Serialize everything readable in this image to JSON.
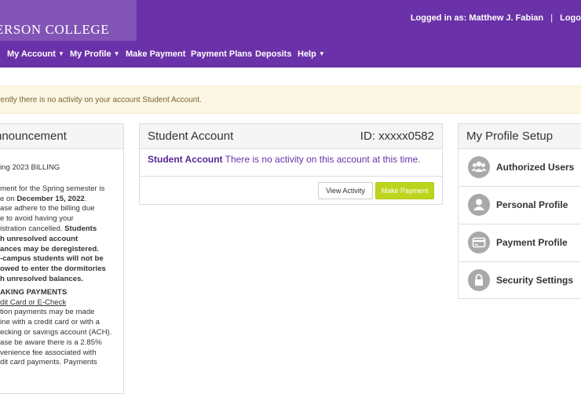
{
  "header": {
    "logo_text": "ERSON COLLEGE",
    "login_prefix": "Logged in as:",
    "user_name": "Matthew J. Fabian",
    "separator": "|",
    "logout_label": "Logo"
  },
  "nav": {
    "items": [
      {
        "label": "My Account",
        "dropdown": true
      },
      {
        "label": "My Profile",
        "dropdown": true
      },
      {
        "label": "Make Payment",
        "dropdown": false
      },
      {
        "label": "Payment Plans",
        "dropdown": false
      },
      {
        "label": "Deposits",
        "dropdown": false
      },
      {
        "label": "Help",
        "dropdown": true
      }
    ]
  },
  "alert": {
    "text": "rrently there is no activity on your account Student Account."
  },
  "announcement": {
    "title": "nnouncement",
    "heading": "ing 2023 BILLING",
    "para1_a": "ment for the Spring semester is",
    "para1_b": "e on ",
    "due_date": "December 15, 2022",
    "para1_c": ".",
    "para1_d": "ase adhere to the billing due",
    "para1_e": "e to avoid having your",
    "para1_f": "istration cancelled. ",
    "bold_1": "Students",
    "bold_2": "h unresolved account",
    "bold_3": "ances may be deregistered.",
    "bold_4": "-campus students will not be",
    "bold_5": "owed to enter the dormitories",
    "bold_6": "h unresolved balances.",
    "making_title": "AKING PAYMENTS",
    "making_link": "dit Card or E-Check",
    "body_1": "tion payments may be made",
    "body_2": "ine with a credit card or with a",
    "body_3": "ecking or savings account (ACH).",
    "body_4": "ase be aware there is a 2.85%",
    "body_5": "venience fee associated with",
    "body_6": "dit card payments. Payments"
  },
  "student_account": {
    "title": "Student Account",
    "id_label": "ID: xxxxx0582",
    "message_bold": "Student Account",
    "message_rest": " There is no activity on this account at this time.",
    "view_button": "View Activity",
    "pay_button": "Make Payment"
  },
  "profile_setup": {
    "title": "My Profile Setup",
    "items": [
      {
        "label": "Authorized Users",
        "icon": "users-icon"
      },
      {
        "label": "Personal Profile",
        "icon": "person-icon"
      },
      {
        "label": "Payment Profile",
        "icon": "credit-card-icon"
      },
      {
        "label": "Security Settings",
        "icon": "lock-icon"
      }
    ]
  },
  "colors": {
    "brand_purple": "#6a31a8",
    "accent_green": "#bdd41c",
    "alert_bg": "#fcf6e5"
  }
}
